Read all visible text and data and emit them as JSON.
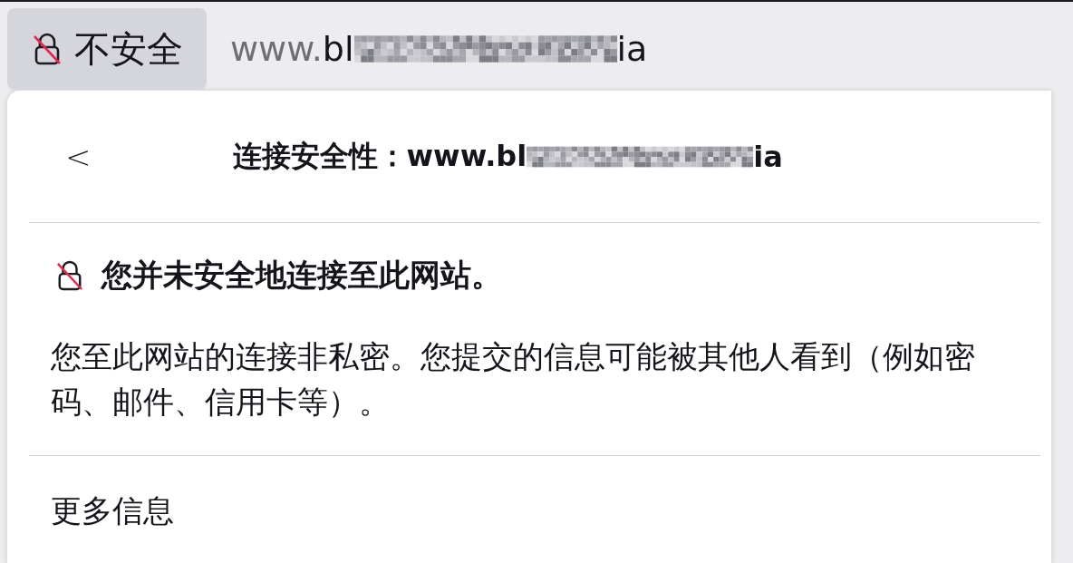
{
  "address_bar": {
    "security_badge": {
      "label": "不安全",
      "secure": false
    },
    "url_prefix": "www.",
    "url_start": "bl",
    "url_redacted": true,
    "url_end": "ia"
  },
  "panel": {
    "back_label": "<",
    "title": "连接安全性：",
    "title_url_start": "www.bl",
    "title_url_redacted": true,
    "title_url_end": "ia",
    "status": {
      "secure": false,
      "heading": "您并未安全地连接至此网站。"
    },
    "description": "您至此网站的连接非私密。您提交的信息可能被其他人看到（例如密码、邮件、信用卡等）。",
    "more_info": "更多信息"
  }
}
